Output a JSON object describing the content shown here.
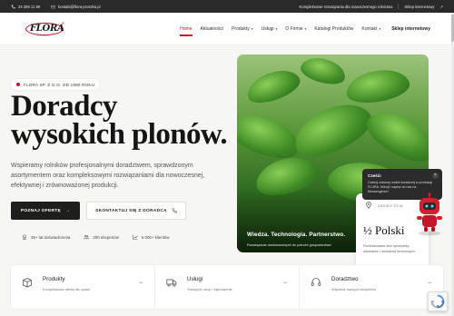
{
  "topbar": {
    "phone": "34 359 11 89",
    "email": "kontakt@flora-proszka.pl",
    "tagline": "Kompleksowe rozwiązania dla nowoczesnego rolnictwa",
    "shop_link": "Sklep internetowy"
  },
  "logo": {
    "name": "FLORA",
    "subtitle": "PROSZKA"
  },
  "nav": {
    "items": [
      {
        "label": "Home",
        "active": true,
        "dropdown": false
      },
      {
        "label": "Aktualności",
        "active": false,
        "dropdown": false
      },
      {
        "label": "Produkty",
        "active": false,
        "dropdown": true
      },
      {
        "label": "Usługi",
        "active": false,
        "dropdown": true
      },
      {
        "label": "O Firmie",
        "active": false,
        "dropdown": true
      },
      {
        "label": "Katalogi Produktów",
        "active": false,
        "dropdown": false
      },
      {
        "label": "Kontakt",
        "active": false,
        "dropdown": true
      }
    ],
    "shop": "Sklep internetowy"
  },
  "hero": {
    "badge": "FLORA SP. Z O.O. OD 1990 ROKU",
    "headline_line1": "Doradcy",
    "headline_line2": "wysokich plonów.",
    "lead": "Wspieramy rolników profesjonalnymi doradztwem, sprawdzonym asortymentem oraz kompleksowymi rozwiązaniami dla nowoczesnej, efektywnej i zrównoważonej produkcji.",
    "cta_primary": "POZNAJ OFERTĘ",
    "cta_secondary": "SKONTAKTUJ SIĘ Z DORADCĄ",
    "stats": [
      {
        "icon": "award-icon",
        "text": "35+ lat doświadczenia"
      },
      {
        "icon": "people-icon",
        "text": "200 ekspertów"
      },
      {
        "icon": "chart-icon",
        "text": "5 000+ klientów"
      }
    ]
  },
  "image": {
    "caption_title": "Wiedza. Technologia. Partnerstwo.",
    "caption_sub": "Rozwiązania dostosowanych do potrzeb gospodarstwa"
  },
  "infocard": {
    "label": "ZASIĘG DZIA",
    "value": "½ Polski",
    "desc": "Rozbudowana sieć sprzedaży oddziałów i doradców terenowych"
  },
  "chat": {
    "greeting": "Cześć!",
    "message": "Czekój zobaczy wokół doradczej w produkcji FLORA. Kliknij i napisz do nas na Messengerze!",
    "close": "×"
  },
  "cards": [
    {
      "icon": "box-icon",
      "title": "Produkty",
      "desc": "Kompleksowa ofertą dla upraw"
    },
    {
      "icon": "truck-icon",
      "title": "Usługi",
      "desc": "Transport, skup i zaproszenie"
    },
    {
      "icon": "headset-icon",
      "title": "Doradztwo",
      "desc": "Wsparcie naszych ekspertów"
    }
  ],
  "colors": {
    "accent": "#c8102e",
    "dark": "#1e1e1e",
    "background": "#f6f6f4"
  }
}
